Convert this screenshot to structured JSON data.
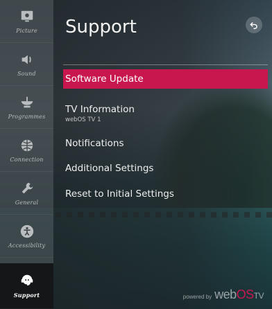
{
  "sidebar": {
    "items": [
      {
        "label": "Picture",
        "icon": "picture-icon"
      },
      {
        "label": "Sound",
        "icon": "speaker-icon"
      },
      {
        "label": "Programmes",
        "icon": "satellite-dish-icon"
      },
      {
        "label": "Connection",
        "icon": "globe-icon"
      },
      {
        "label": "General",
        "icon": "wrench-icon"
      },
      {
        "label": "Accessibility",
        "icon": "accessibility-icon"
      },
      {
        "label": "Support",
        "icon": "headset-icon",
        "active": true
      }
    ]
  },
  "panel": {
    "title": "Support",
    "back_icon": "back-arrow-icon",
    "menu": [
      {
        "label": "Software Update",
        "selected": true
      },
      {
        "label": "TV Information",
        "sub": "webOS TV 1"
      },
      {
        "label": "Notifications"
      },
      {
        "label": "Additional Settings"
      },
      {
        "label": "Reset to Initial Settings"
      }
    ]
  },
  "footer": {
    "powered_by": "powered by",
    "brand_web": "web",
    "brand_os": "OS",
    "brand_tv": "TV"
  },
  "colors": {
    "accent": "#c8174f",
    "sidebar_bg": "#404649",
    "active_bg": "#121214"
  }
}
